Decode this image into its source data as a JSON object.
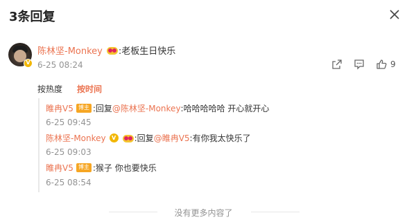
{
  "header": {
    "title": "3条回复"
  },
  "main_comment": {
    "user": "陈林坚-Monkey",
    "text": ":老板生日快乐",
    "time": "6-25 08:24",
    "like_count": "9"
  },
  "sort": {
    "hot_label": "按热度",
    "time_label": "按时间"
  },
  "replies": [
    {
      "user": "睢冉V5",
      "badge": "博主",
      "prefix": ":回复",
      "mention": "@陈林坚-Monkey",
      "text": ":哈哈哈哈哈 开心就开心",
      "time": "6-25 09:45"
    },
    {
      "user": "陈林坚-Monkey",
      "badge": "",
      "prefix": ":回复",
      "mention": "@睢冉V5",
      "text": ":有你我太快乐了",
      "time": "6-25 09:03"
    },
    {
      "user": "睢冉V5",
      "badge": "博主",
      "prefix": "",
      "mention": "",
      "text": ":猴子 你也要快乐",
      "time": "6-25 08:54"
    }
  ],
  "footer": {
    "text": "没有更多内容了"
  },
  "colors": {
    "accent": "#eb7350",
    "muted": "#939393",
    "badge": "#f6a623"
  },
  "icons": [
    "close-icon",
    "share-icon",
    "comment-icon",
    "like-icon",
    "vip-icon",
    "crown-badge-icon"
  ]
}
